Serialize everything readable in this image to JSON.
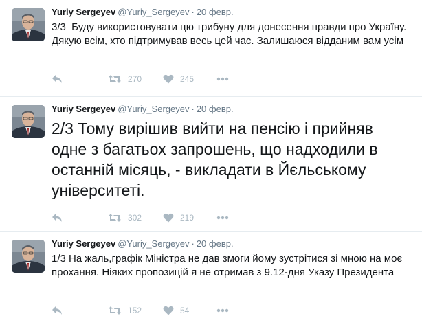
{
  "icons": {
    "reply": "reply-arrow-icon",
    "retweet": "retweet-icon",
    "like": "heart-icon",
    "more": "more-dots-icon"
  },
  "colors": {
    "text": "#14171a",
    "secondary": "#657786",
    "action": "#aab8c2",
    "divider": "#e6ecf0"
  },
  "tweets": [
    {
      "fullname": "Yuriy Sergeyev",
      "username": "@Yuriy_Sergeyev",
      "separator": "·",
      "timestamp": "20 февр.",
      "text": "3/3  Буду використовувати цю трибуну для донесення правди про Україну. Дякую всім, хто підтримував весь цей час. Залишаюся відданим вам усім",
      "retweets": "270",
      "likes": "245"
    },
    {
      "fullname": "Yuriy Sergeyev",
      "username": "@Yuriy_Sergeyev",
      "separator": "·",
      "timestamp": "20 февр.",
      "text": "2/3 Тому вирішив вийти на пенсію і прийняв одне з багатьох запрошень, що надходили в останній місяць, - викладати в Йєльському університеті.",
      "retweets": "302",
      "likes": "219"
    },
    {
      "fullname": "Yuriy Sergeyev",
      "username": "@Yuriy_Sergeyev",
      "separator": "·",
      "timestamp": "20 февр.",
      "text": "1/3 На жаль,графік Міністра не дав змоги йому зустрітися зі мною на моє прохання. Ніяких пропозицій я не отримав з 9.12-дня Указу Президента",
      "retweets": "152",
      "likes": "54"
    }
  ]
}
